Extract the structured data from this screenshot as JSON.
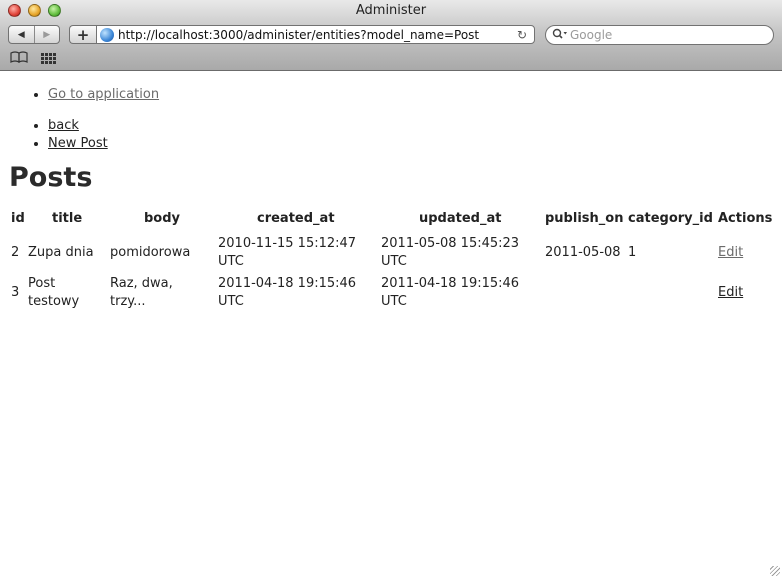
{
  "window": {
    "title": "Administer"
  },
  "toolbar": {
    "back_glyph": "◀",
    "forward_glyph": "▶",
    "add_glyph": "+",
    "url": "http://localhost:3000/administer/entities?model_name=Post",
    "reload_glyph": "↻",
    "search_glyph": "🔍",
    "search_placeholder": "Google",
    "bookmarks_glyph": "📖"
  },
  "nav": {
    "go_to_application": "Go to application",
    "back": "back",
    "new_post": "New Post"
  },
  "page": {
    "heading": "Posts"
  },
  "table": {
    "headers": {
      "id": "id",
      "title": "title",
      "body": "body",
      "created_at": "created_at",
      "updated_at": "updated_at",
      "publish_on": "publish_on",
      "category_id": "category_id",
      "actions": "Actions"
    },
    "rows": [
      {
        "id": "2",
        "title": "Zupa dnia",
        "body": "pomidorowa",
        "created_at_1": "2010-11-15 15:12:47",
        "created_at_2": "UTC",
        "updated_at_1": "2011-05-08 15:45:23",
        "updated_at_2": "UTC",
        "publish_on": "2011-05-08",
        "category_id": "1",
        "action": "Edit"
      },
      {
        "id": "3",
        "title_1": "Post",
        "title_2": "testowy",
        "body_1": "Raz, dwa,",
        "body_2": "trzy...",
        "created_at_1": "2011-04-18 19:15:46",
        "created_at_2": "UTC",
        "updated_at_1": "2011-04-18 19:15:46",
        "updated_at_2": "UTC",
        "publish_on": "",
        "category_id": "",
        "action": "Edit"
      }
    ]
  }
}
